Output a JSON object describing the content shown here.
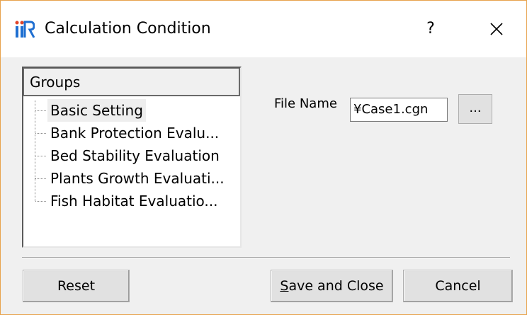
{
  "window": {
    "title": "Calculation Condition",
    "help_label": "?",
    "icons": {
      "app": "iric-logo-icon",
      "close": "close-icon"
    }
  },
  "groups": {
    "header": "Groups",
    "items": [
      {
        "label": "Basic Setting",
        "selected": true
      },
      {
        "label": "Bank Protection Evalu..."
      },
      {
        "label": "Bed Stability Evaluation"
      },
      {
        "label": "Plants Growth Evaluati..."
      },
      {
        "label": "Fish Habitat Evaluatio..."
      }
    ]
  },
  "file": {
    "label": "File Name",
    "value": "¥Case1.cgn",
    "browse_label": "..."
  },
  "buttons": {
    "reset": "Reset",
    "save_mnemonic": "S",
    "save_rest": "ave and Close",
    "cancel": "Cancel"
  },
  "colors": {
    "border_accent": "#e8a24c",
    "logo_blue": "#1f6fd1"
  }
}
